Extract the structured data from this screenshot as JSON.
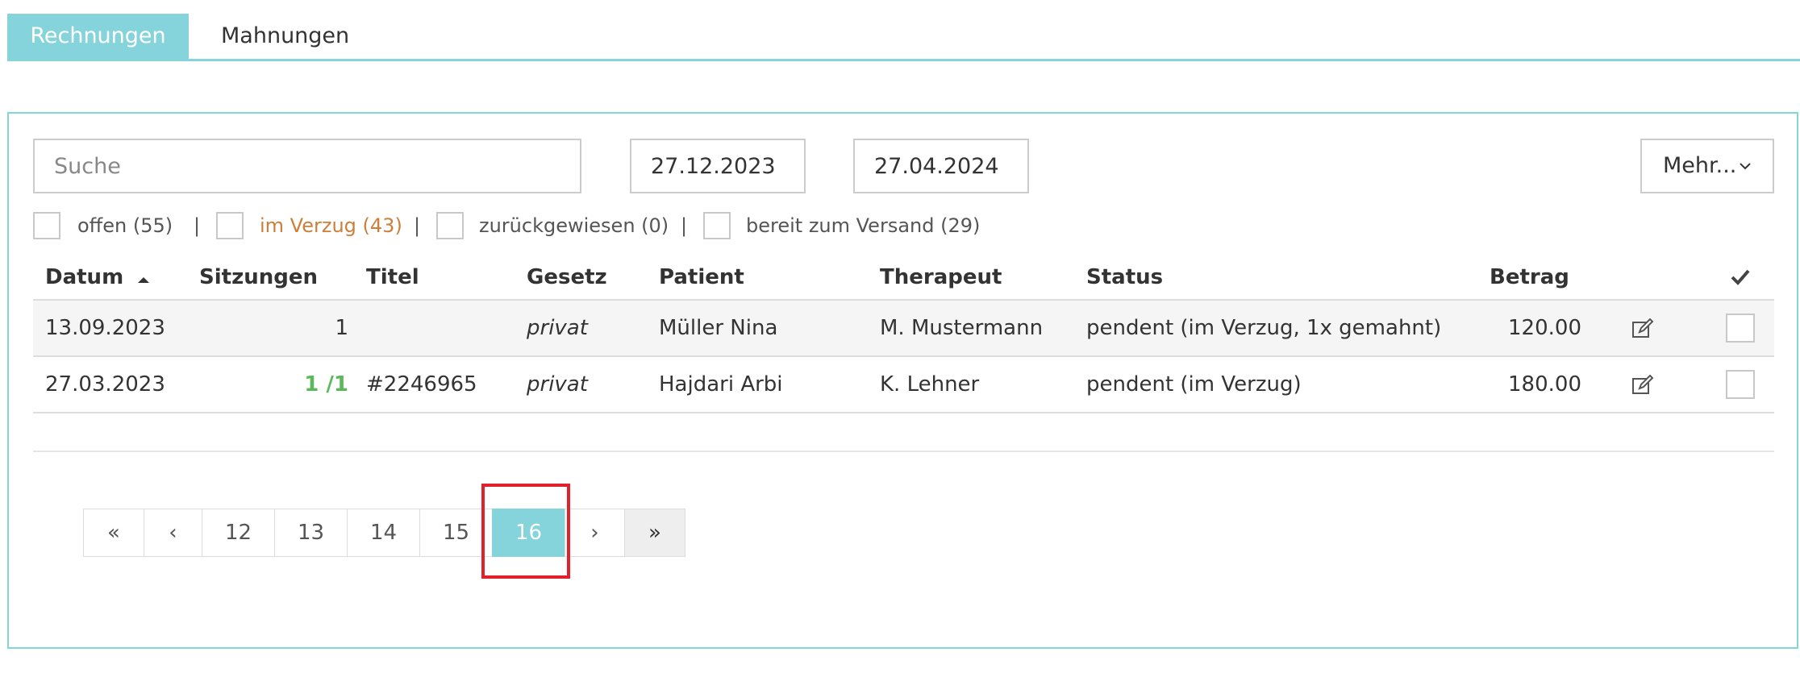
{
  "tabs": [
    {
      "label": "Rechnungen",
      "active": true
    },
    {
      "label": "Mahnungen",
      "active": false
    }
  ],
  "search": {
    "placeholder": "Suche",
    "value": ""
  },
  "date_from": "27.12.2023",
  "date_to": "27.04.2024",
  "mehr_label": "Mehr...",
  "filters": [
    {
      "label": "offen (55)"
    },
    {
      "label": "im Verzug (43)"
    },
    {
      "label": "zurückgewiesen (0)"
    },
    {
      "label": "bereit zum Versand (29)"
    }
  ],
  "filter_separator": "|",
  "columns": {
    "datum": "Datum",
    "sitzungen": "Sitzungen",
    "titel": "Titel",
    "gesetz": "Gesetz",
    "patient": "Patient",
    "therapeut": "Therapeut",
    "status": "Status",
    "betrag": "Betrag"
  },
  "rows": [
    {
      "datum": "13.09.2023",
      "sitzungen": "1",
      "titel": "",
      "gesetz": "privat",
      "patient": "Müller Nina",
      "therapeut": "M. Mustermann",
      "status": "pendent (im Verzug, 1x gemahnt)",
      "betrag": "120.00"
    },
    {
      "datum": "27.03.2023",
      "sitzungen": "1 /1",
      "titel": "#2246965",
      "gesetz": "privat",
      "patient": "Hajdari Arbi",
      "therapeut": "K. Lehner",
      "status": "pendent (im Verzug)",
      "betrag": "180.00"
    }
  ],
  "pagination": {
    "first": "«",
    "prev": "‹",
    "pages": [
      "12",
      "13",
      "14",
      "15",
      "16"
    ],
    "current": "16",
    "next": "›",
    "last": "»"
  },
  "colors": {
    "accent": "#86d4db",
    "warning": "#cd7f3a",
    "success": "#5cb85c",
    "highlight": "#e0202a"
  },
  "icons": {
    "sort": "sort-asc-icon",
    "check": "check-icon",
    "edit": "edit-icon",
    "chevron": "chevron-down-icon"
  }
}
